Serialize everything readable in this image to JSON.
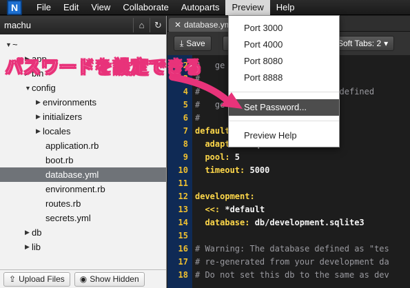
{
  "menubar": {
    "logo": "N",
    "items": [
      "File",
      "Edit",
      "View",
      "Collaborate",
      "Autoparts",
      "Preview",
      "Help"
    ]
  },
  "sidebar": {
    "title": "machu",
    "home_icon": "home-icon",
    "refresh_icon": "refresh-icon",
    "tree": [
      {
        "label": "~",
        "arrow": "down"
      },
      {
        "label": "app",
        "arrow": "right"
      },
      {
        "label": "bin",
        "arrow": "right"
      },
      {
        "label": "config",
        "arrow": "down"
      },
      {
        "label": "environments",
        "arrow": "right"
      },
      {
        "label": "initializers",
        "arrow": "right"
      },
      {
        "label": "locales",
        "arrow": "right"
      },
      {
        "label": "application.rb",
        "arrow": ""
      },
      {
        "label": "boot.rb",
        "arrow": ""
      },
      {
        "label": "database.yml",
        "arrow": "",
        "selected": true
      },
      {
        "label": "environment.rb",
        "arrow": ""
      },
      {
        "label": "routes.rb",
        "arrow": ""
      },
      {
        "label": "secrets.yml",
        "arrow": ""
      },
      {
        "label": "db",
        "arrow": "right"
      },
      {
        "label": "lib",
        "arrow": "right"
      }
    ],
    "upload_label": "Upload Files",
    "show_hidden_label": "Show Hidden"
  },
  "editor": {
    "tab_label": "database.yml",
    "save_label": "Save",
    "soft_tabs_label": "Soft Tabs: 2",
    "lines": [
      {
        "n": "2",
        "t": "#   ge"
      },
      {
        "n": "3",
        "t": "#"
      },
      {
        "n": "4",
        "t": "#                      em is defined"
      },
      {
        "n": "5",
        "t": "#   ge"
      },
      {
        "n": "6",
        "t": "#"
      },
      {
        "n": "7",
        "t": "default"
      },
      {
        "n": "8",
        "t": "  adapter: sqlite3"
      },
      {
        "n": "9",
        "t": "  pool: 5"
      },
      {
        "n": "10",
        "t": "  timeout: 5000"
      },
      {
        "n": "11",
        "t": ""
      },
      {
        "n": "12",
        "t": "development:"
      },
      {
        "n": "13",
        "t": "  <<: *default"
      },
      {
        "n": "14",
        "t": "  database: db/development.sqlite3"
      },
      {
        "n": "15",
        "t": ""
      },
      {
        "n": "16",
        "t": "# Warning: The database defined as \"tes"
      },
      {
        "n": "17",
        "t": "# re-generated from your development da"
      },
      {
        "n": "18",
        "t": "# Do not set this db to the same as dev"
      }
    ]
  },
  "preview_menu": {
    "items": [
      "Port 3000",
      "Port 4000",
      "Port 8080",
      "Port 8888",
      "Set Password...",
      "Preview Help"
    ]
  },
  "annotation": {
    "text": "パスワードを設定できる",
    "color": "#e8337a"
  }
}
